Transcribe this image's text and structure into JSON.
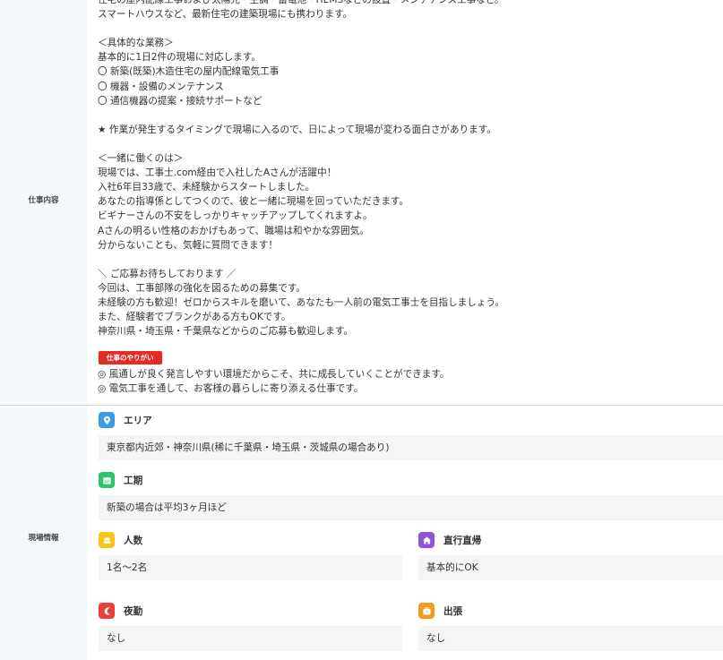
{
  "job": {
    "label": "仕事内容",
    "description": "住宅の屋内配線工事および太陽光・空調・蓄電池・HEMSなどの設置・メンテナンス工事など。\nスマートハウスなど、最新住宅の建築現場にも携わります。\n\n＜具体的な業務＞\n基本的に1日2件の現場に対応します。\n〇 新築(既築)木造住宅の屋内配線電気工事\n〇 機器・設備のメンテナンス\n〇 通信機器の提案・接続サポートなど\n\n★ 作業が発生するタイミングで現場に入るので、日によって現場が変わる面白さがあります。\n\n＜一緒に働くのは＞\n現場では、工事士.com経由で入社したAさんが活躍中！\n入社6年目33歳で、未経験からスタートしました。\nあなたの指導係としてつくので、彼と一緒に現場を回っていただきます。\nビギナーさんの不安をしっかりキャッチアップしてくれますよ。\nAさんの明るい性格のおかげもあって、職場は和やかな雰囲気。\n分からないことも、気軽に質問できます！\n\n＼ ご応募お待ちしております ／\n今回は、工事部隊の強化を図るための募集です。\n未経験の方も歓迎！ゼロからスキルを磨いて、あなたも一人前の電気工事士を目指しましょう。\nまた、経験者でブランクがある方もOKです。\n神奈川県・埼玉県・千葉県などからのご応募も歓迎します。",
    "yarigai_badge": "仕事のやりがい",
    "yarigai_text": "◎ 風通しが良く発言しやすい環境だからこそ、共に成長していくことができます。\n◎ 電気工事を通して、お客様の暮らしに寄り添える仕事です。"
  },
  "site": {
    "label": "現場情報",
    "area": {
      "title": "エリア",
      "value": "東京都内近郊・神奈川県(稀に千葉県・埼玉県・茨城県の場合あり)",
      "icon": "location-pin-icon",
      "color": "#3b9de0"
    },
    "period": {
      "title": "工期",
      "value": "新築の場合は平均3ヶ月ほど",
      "icon": "calendar-icon",
      "color": "#2fc46b"
    },
    "people": {
      "title": "人数",
      "value": "1名～2名",
      "icon": "people-icon",
      "color": "#f5c518"
    },
    "direct": {
      "title": "直行直帰",
      "value": "基本的にOK",
      "icon": "home-icon",
      "color": "#8c56d6"
    },
    "night": {
      "title": "夜勤",
      "value": "なし",
      "icon": "moon-icon",
      "color": "#e8413a"
    },
    "trip": {
      "title": "出張",
      "value": "なし",
      "icon": "suitcase-icon",
      "color": "#f59a1b"
    }
  }
}
